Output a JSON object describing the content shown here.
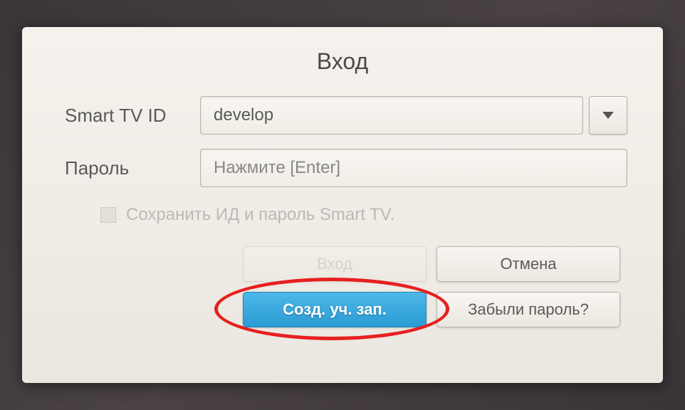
{
  "dialog": {
    "title": "Вход",
    "fields": {
      "id": {
        "label": "Smart TV ID",
        "value": "develop"
      },
      "password": {
        "label": "Пароль",
        "placeholder": "Нажмите [Enter]"
      }
    },
    "checkbox": {
      "label": "Сохранить ИД и пароль Smart TV."
    },
    "buttons": {
      "login": "Вход",
      "cancel": "Отмена",
      "create": "Созд. уч. зап.",
      "forgot": "Забыли пароль?"
    }
  }
}
